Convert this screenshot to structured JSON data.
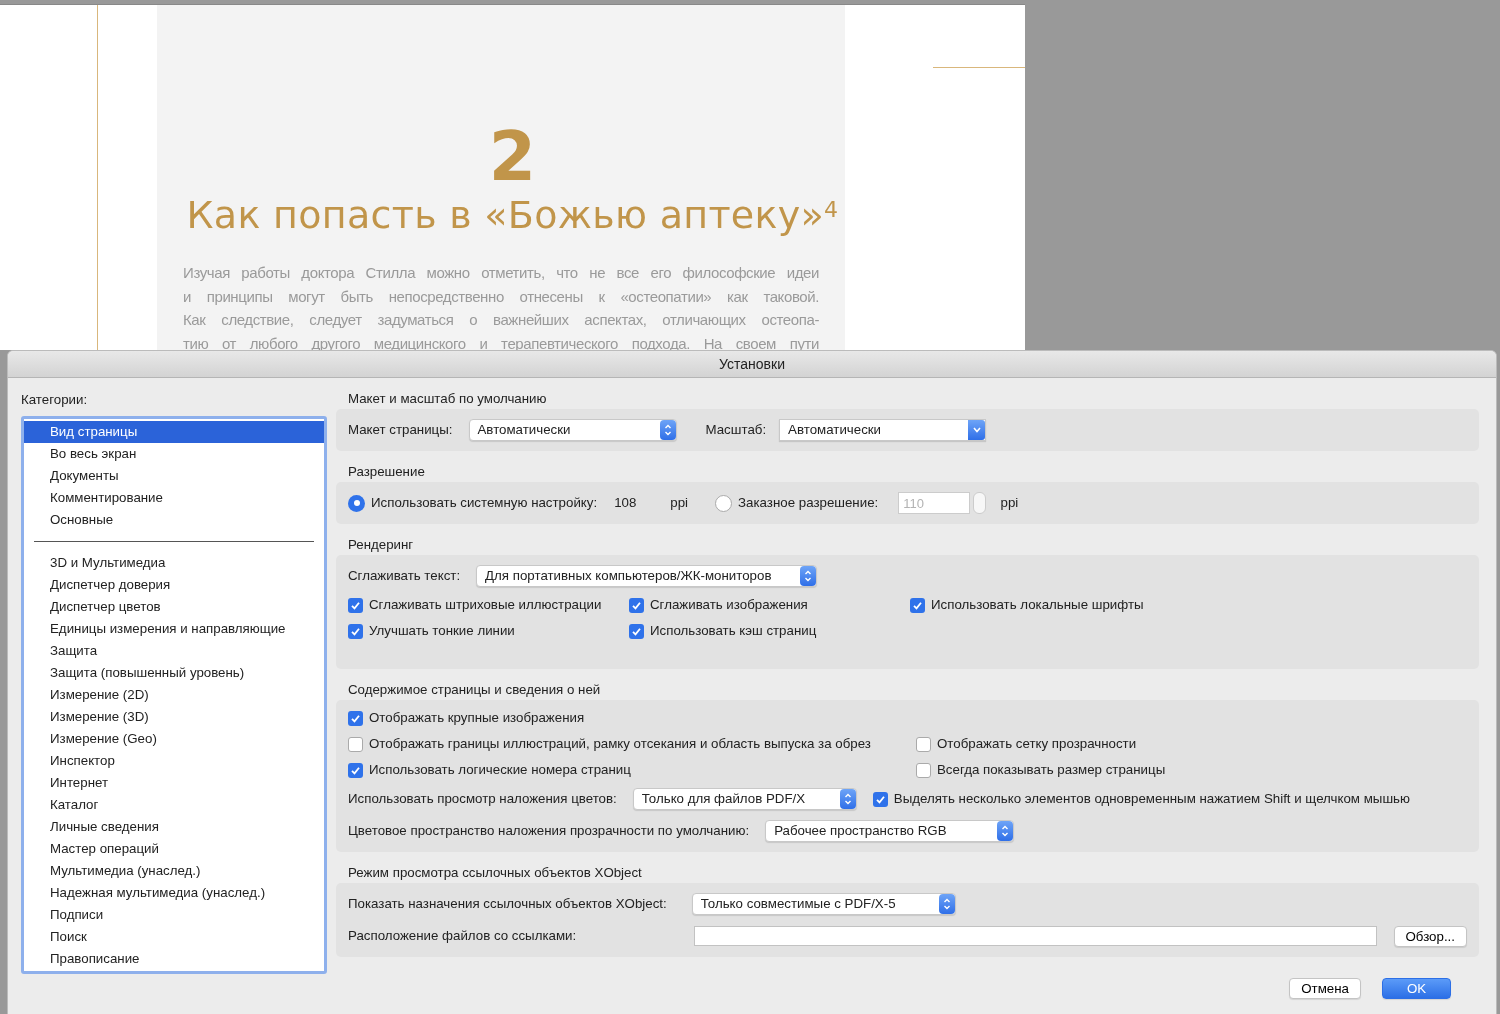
{
  "document": {
    "chapter_number": "2",
    "chapter_title": "Как попасть в «Божью аптеку»$^{4}$",
    "body_lines": [
      "Изучая работы доктора Стилла можно отметить, что не все его философские идеи",
      "и принципы могут быть непосредственно отнесены к «остеопатии» как таковой.",
      "Как следствие, следует задуматься о важнейших аспектах, отличающих остеопа-",
      "тию от любого другого медицинского и терапевтического подхода. На своем пути"
    ]
  },
  "dialog": {
    "title": "Установки",
    "categories_label": "Категории:",
    "category_groups": [
      [
        {
          "label": "Вид страницы",
          "selected": true
        },
        {
          "label": "Во весь экран",
          "selected": false
        },
        {
          "label": "Документы",
          "selected": false
        },
        {
          "label": "Комментирование",
          "selected": false
        },
        {
          "label": "Основные",
          "selected": false
        }
      ],
      [
        {
          "label": "3D и Мультимедиа",
          "selected": false
        },
        {
          "label": "Диспетчер доверия",
          "selected": false
        },
        {
          "label": "Диспетчер цветов",
          "selected": false
        },
        {
          "label": "Единицы измерения и направляющие",
          "selected": false
        },
        {
          "label": "Защита",
          "selected": false
        },
        {
          "label": "Защита (повышенный уровень)",
          "selected": false
        },
        {
          "label": "Измерение (2D)",
          "selected": false
        },
        {
          "label": "Измерение (3D)",
          "selected": false
        },
        {
          "label": "Измерение (Geo)",
          "selected": false
        },
        {
          "label": "Инспектор",
          "selected": false
        },
        {
          "label": "Интернет",
          "selected": false
        },
        {
          "label": "Каталог",
          "selected": false
        },
        {
          "label": "Личные сведения",
          "selected": false
        },
        {
          "label": "Мастер операций",
          "selected": false
        },
        {
          "label": "Мультимедиа (унаслед.)",
          "selected": false
        },
        {
          "label": "Надежная мультимедиа (унаслед.)",
          "selected": false
        },
        {
          "label": "Подписи",
          "selected": false
        },
        {
          "label": "Поиск",
          "selected": false
        },
        {
          "label": "Правописание",
          "selected": false
        }
      ]
    ],
    "sections": [
      {
        "title": "Макет и масштаб по умолчанию",
        "rows": [
          [
            {
              "kind": "label",
              "text": "Макет страницы:"
            },
            {
              "kind": "popup",
              "value": "Автоматически"
            },
            {
              "kind": "label",
              "text": "Масштаб:"
            },
            {
              "kind": "combo",
              "value": "Автоматически"
            }
          ]
        ]
      },
      {
        "title": "Разрешение",
        "rows": [
          [
            {
              "kind": "radio",
              "text": "Использовать системную настройку:",
              "selected": true
            },
            {
              "kind": "label",
              "text": "108"
            },
            {
              "kind": "label",
              "text": "ppi"
            },
            {
              "kind": "radio",
              "text": "Заказное разрешение:",
              "selected": false
            },
            {
              "kind": "spin",
              "value": "110",
              "disabled": true
            },
            {
              "kind": "label",
              "text": "ppi"
            }
          ]
        ]
      },
      {
        "title": "Рендеринг",
        "rows": [
          [
            {
              "kind": "label",
              "text": "Сглаживать текст:"
            },
            {
              "kind": "popup",
              "value": "Для портативных компьютеров/ЖК-мониторов"
            }
          ],
          [
            {
              "kind": "checkbox",
              "text": "Сглаживать штриховые иллюстрации",
              "checked": true
            },
            {
              "kind": "checkbox",
              "text": "Сглаживать изображения",
              "checked": true
            },
            {
              "kind": "checkbox",
              "text": "Использовать локальные шрифты",
              "checked": true
            }
          ],
          [
            {
              "kind": "checkbox",
              "text": "Улучшать тонкие линии",
              "checked": true
            },
            {
              "kind": "checkbox",
              "text": "Использовать кэш страниц",
              "checked": true
            }
          ]
        ]
      },
      {
        "title": "Содержимое страницы и сведения о ней",
        "rows": [
          [
            {
              "kind": "checkbox",
              "text": "Отображать крупные изображения",
              "checked": true
            }
          ],
          [
            {
              "kind": "checkbox",
              "text": "Отображать границы иллюстраций, рамку отсекания и область выпуска за обрез",
              "checked": false
            },
            {
              "kind": "checkbox",
              "text": "Отображать сетку прозрачности",
              "checked": false
            }
          ],
          [
            {
              "kind": "checkbox",
              "text": "Использовать логические номера страниц",
              "checked": true
            },
            {
              "kind": "checkbox",
              "text": "Всегда показывать размер страницы",
              "checked": false
            }
          ],
          [
            {
              "kind": "label",
              "text": "Использовать просмотр наложения цветов:"
            },
            {
              "kind": "popup",
              "value": "Только для файлов PDF/X"
            },
            {
              "kind": "checkbox",
              "text": "Выделять несколько элементов одновременным нажатием Shift и щелчком мышью",
              "checked": true
            }
          ],
          [
            {
              "kind": "label",
              "text": "Цветовое пространство наложения прозрачности по умолчанию:"
            },
            {
              "kind": "popup",
              "value": "Рабочее пространство RGB"
            }
          ]
        ]
      },
      {
        "title": "Режим просмотра ссылочных объектов XObject",
        "rows": [
          [
            {
              "kind": "label",
              "text": "Показать назначения ссылочных объектов XObject:"
            },
            {
              "kind": "popup",
              "value": "Только совместимые с PDF/X-5"
            }
          ],
          [
            {
              "kind": "label",
              "text": "Расположение файлов со ссылками:"
            },
            {
              "kind": "field"
            },
            {
              "kind": "button",
              "text": "Обзор..."
            }
          ]
        ]
      }
    ],
    "buttons": [
      {
        "text": "Отмена",
        "default": false
      },
      {
        "text": "OK",
        "default": true
      }
    ]
  }
}
